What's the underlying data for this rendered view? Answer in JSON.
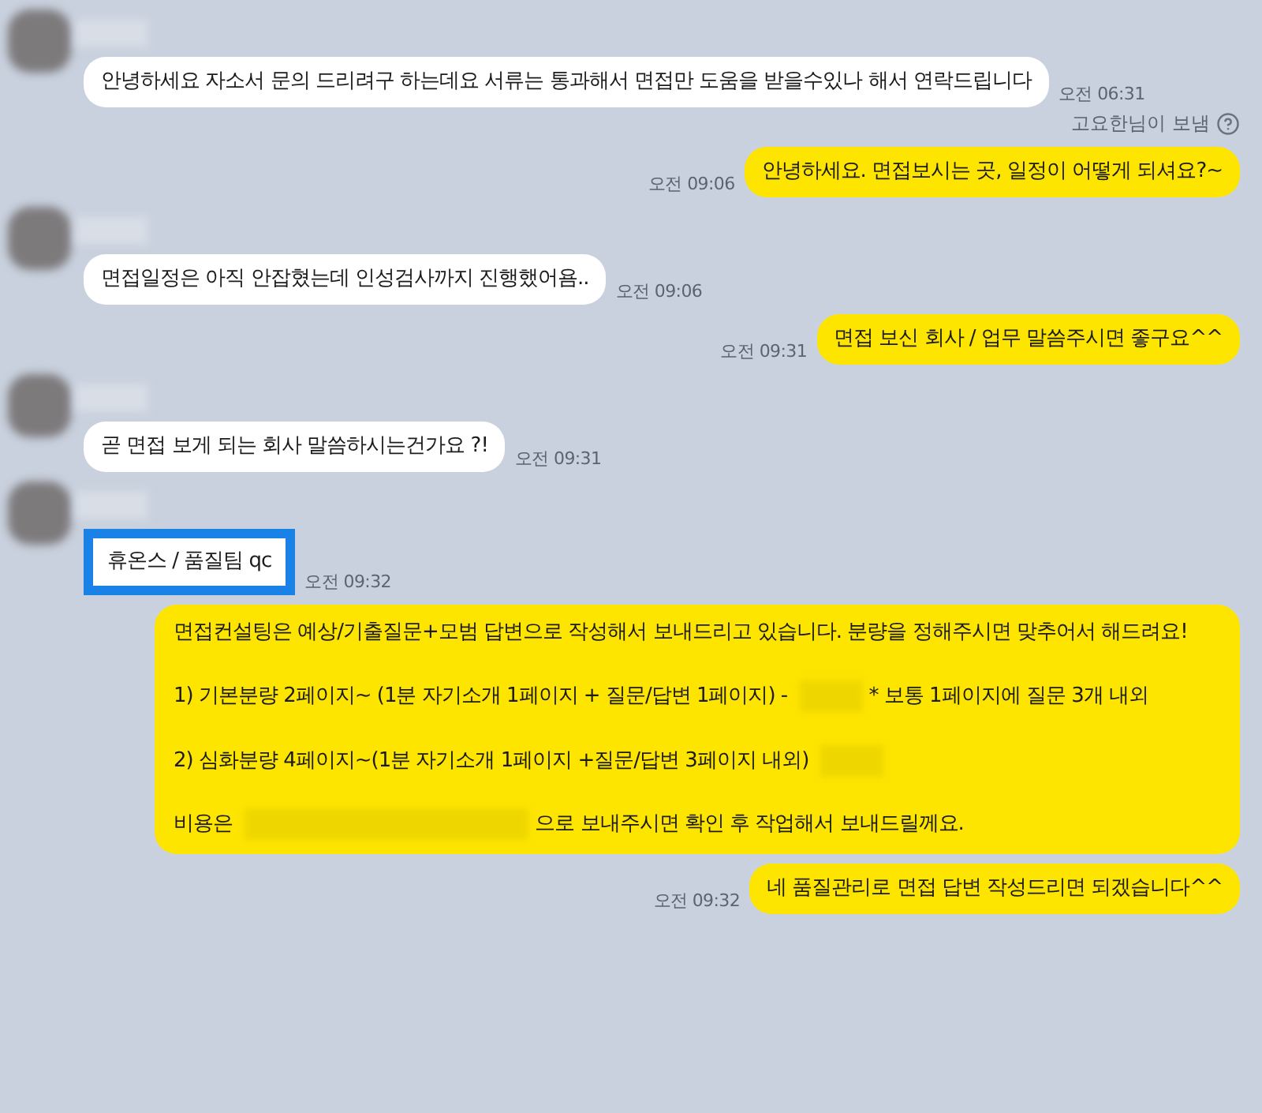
{
  "messages": [
    {
      "kind": "incoming",
      "text": "안녕하세요 자소서 문의 드리려구 하는데요 서류는 통과해서 면접만 도움을 받을수있나 해서 연락드립니다",
      "time": "오전 06:31",
      "highlighted": false
    },
    {
      "kind": "note",
      "text": "고요한님이 보냄"
    },
    {
      "kind": "outgoing",
      "text": "안녕하세요. 면접보시는 곳, 일정이 어떻게 되셔요?~",
      "time": "오전 09:06"
    },
    {
      "kind": "incoming",
      "text": "면접일정은 아직 안잡혔는데 인성검사까지 진행했어욤..",
      "time": "오전 09:06",
      "highlighted": false
    },
    {
      "kind": "outgoing",
      "text": "면접 보신 회사 / 업무 말씀주시면 좋구요^^",
      "time": "오전 09:31"
    },
    {
      "kind": "incoming",
      "text": "곧 면접 보게 되는 회사 말씀하시는건가요 ?!",
      "time": "오전 09:31",
      "highlighted": false
    },
    {
      "kind": "incoming",
      "text": "휴온스 / 품질팀 qc",
      "time": "오전 09:32",
      "highlighted": true
    },
    {
      "kind": "outgoing",
      "paragraphs": [
        [
          {
            "kind": "text",
            "text": "면접컨설팅은 예상/기출질문+모범 답변으로 작성해서 보내드리고 있습니다. 분량을 정해주시면 맞추어서 해드려요!"
          }
        ],
        [
          {
            "kind": "text",
            "text": "1) 기본분량 2페이지~ (1분 자기소개 1페이지 + 질문/답변 1페이지) -"
          },
          {
            "kind": "blur"
          },
          {
            "kind": "text",
            "text": "* 보통 1페이지에 질문 3개 내외"
          }
        ],
        [
          {
            "kind": "text",
            "text": "2) 심화분량 4페이지~(1분 자기소개 1페이지 +질문/답변 3페이지 내외)"
          },
          {
            "kind": "blur"
          }
        ],
        [
          {
            "kind": "text",
            "text": "비용은"
          },
          {
            "kind": "wide_blur"
          },
          {
            "kind": "text",
            "text": "으로 보내주시면 확인 후 작업해서 보내드릴께요."
          }
        ]
      ]
    },
    {
      "kind": "outgoing",
      "text": "네 품질관리로 면접 답변 작성드리면 되겠습니다^^",
      "time": "오전 09:32"
    }
  ]
}
